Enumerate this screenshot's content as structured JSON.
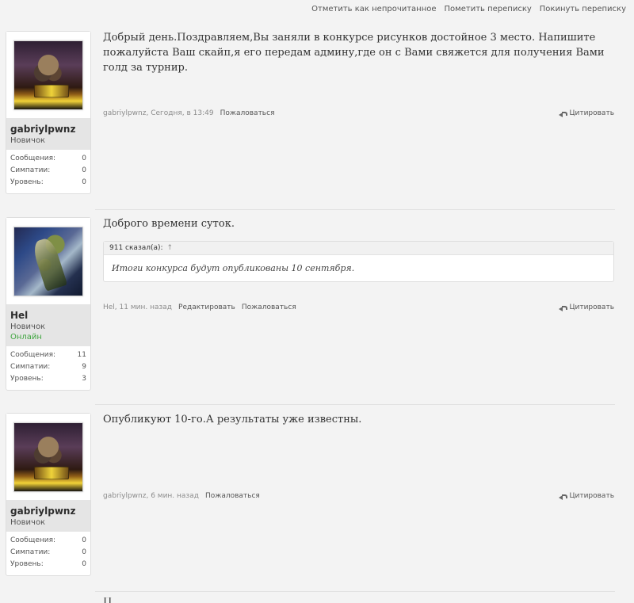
{
  "topbar": {
    "links": [
      "Отметить как непрочитанное",
      "Пометить переписку",
      "Покинуть переписку"
    ]
  },
  "posts": [
    {
      "user": {
        "name": "gabriylpwnz",
        "rank": "Новичок",
        "status": "",
        "stats": [
          {
            "label": "Сообщения:",
            "value": "0"
          },
          {
            "label": "Симпатии:",
            "value": "0"
          },
          {
            "label": "Уровень:",
            "value": "0"
          }
        ]
      },
      "message": "Добрый день.Поздравляем,Вы заняли в конкурсе рисунков достойное 3 место. Напишите пожалуйста Ваш скайп,я его передам админу,где он с Вами свяжется для получения Вами голд за турнир.",
      "meta": {
        "author_time": "gabriylpwnz, Сегодня, в 13:49",
        "actions": [
          "Пожаловаться"
        ],
        "quote_label": "Цитировать"
      }
    },
    {
      "user": {
        "name": "Hel",
        "rank": "Новичок",
        "status": "Онлайн",
        "stats": [
          {
            "label": "Сообщения:",
            "value": "11"
          },
          {
            "label": "Симпатии:",
            "value": "9"
          },
          {
            "label": "Уровень:",
            "value": "3"
          }
        ]
      },
      "message": "Доброго времени суток.",
      "quote": {
        "header": "911 сказал(а):",
        "arrow": "↑",
        "body": "Итоги конкурса будут опубликованы 10 сентября."
      },
      "meta": {
        "author_time": "Hel, 11 мин. назад",
        "actions": [
          "Редактировать",
          "Пожаловаться"
        ],
        "quote_label": "Цитировать"
      }
    },
    {
      "user": {
        "name": "gabriylpwnz",
        "rank": "Новичок",
        "status": "",
        "stats": [
          {
            "label": "Сообщения:",
            "value": "0"
          },
          {
            "label": "Симпатии:",
            "value": "0"
          },
          {
            "label": "Уровень:",
            "value": "0"
          }
        ]
      },
      "message": "Опубликуют 10-го.А результаты уже известны.",
      "meta": {
        "author_time": "gabriylpwnz, 6 мин. назад",
        "actions": [
          "Пожаловаться"
        ],
        "quote_label": "Цитировать"
      }
    }
  ],
  "next_post_fragment": "П",
  "colors": {
    "background": "#f3f3f3",
    "card_meta": "#e5e5e5",
    "online": "#40a640"
  },
  "icons": {
    "quote": "reply-arrow-icon",
    "quote_header": "up-arrow-icon"
  }
}
